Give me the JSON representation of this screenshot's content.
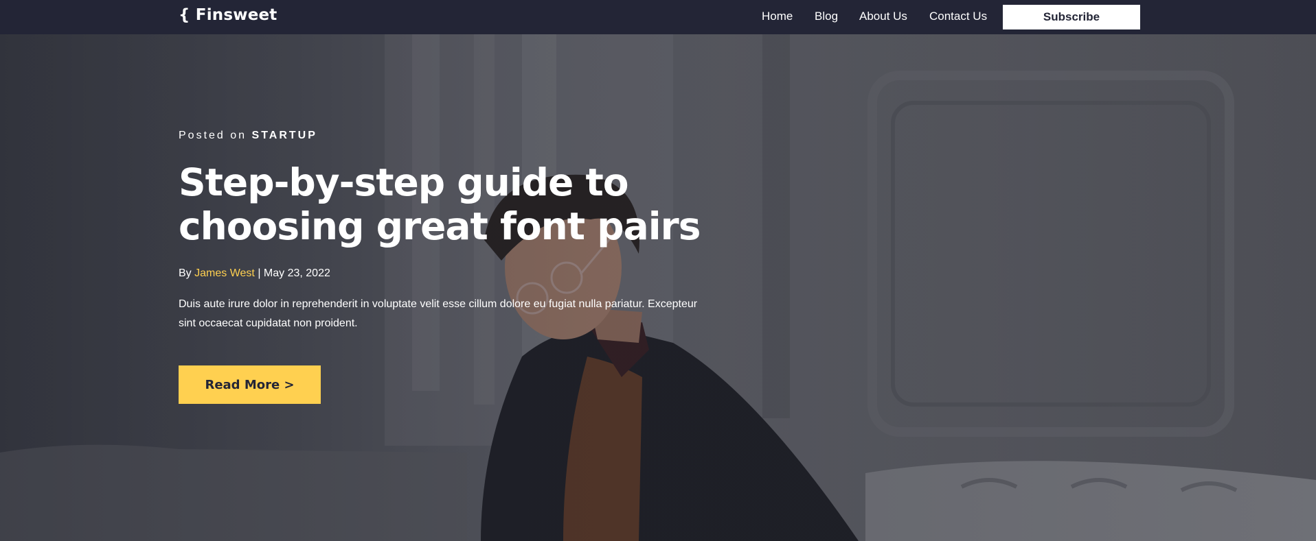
{
  "nav": {
    "logo": "{ Finsweet",
    "links": [
      "Home",
      "Blog",
      "About Us",
      "Contact Us"
    ],
    "subscribe_label": "Subscribe"
  },
  "hero": {
    "posted_prefix": "Posted on",
    "category": "STARTUP",
    "headline": "Step-by-step guide to choosing great font pairs",
    "by_label": "By",
    "author": "James West",
    "separator": "|",
    "date": "May 23, 2022",
    "excerpt": "Duis aute irure dolor in reprehenderit in voluptate velit esse cillum dolore eu fugiat nulla pariatur. Excepteur sint occaecat cupidatat non proident.",
    "read_more_label": "Read More >"
  },
  "colors": {
    "navy": "#232536",
    "accent_yellow": "#FFD050",
    "white": "#FFFFFF"
  }
}
